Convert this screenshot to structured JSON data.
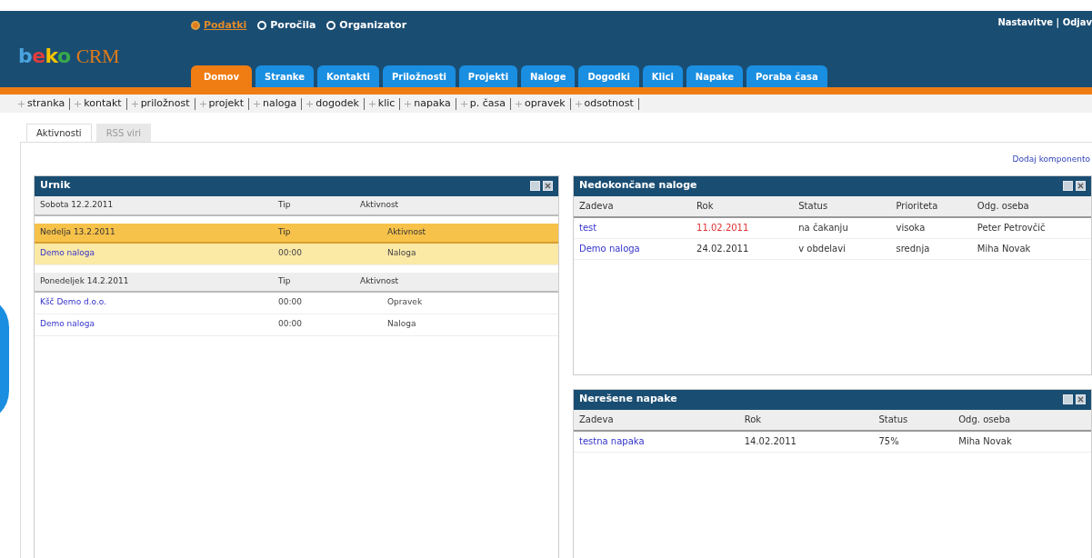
{
  "modules": [
    {
      "label": "Podatki",
      "selected": true
    },
    {
      "label": "Poročila",
      "selected": false
    },
    {
      "label": "Organizator",
      "selected": false
    }
  ],
  "user_links": "Nastavitve | Odjav",
  "logo": {
    "word": "beko",
    "suffix": "CRM"
  },
  "tabs": [
    {
      "label": "Domov",
      "selected": true
    },
    {
      "label": "Stranke",
      "selected": false
    },
    {
      "label": "Kontakti",
      "selected": false
    },
    {
      "label": "Priložnosti",
      "selected": false
    },
    {
      "label": "Projekti",
      "selected": false
    },
    {
      "label": "Naloge",
      "selected": false
    },
    {
      "label": "Dogodki",
      "selected": false
    },
    {
      "label": "Klici",
      "selected": false
    },
    {
      "label": "Napake",
      "selected": false
    },
    {
      "label": "Poraba časa",
      "selected": false
    }
  ],
  "quick_add": [
    "stranka",
    "kontakt",
    "priložnost",
    "projekt",
    "naloga",
    "dogodek",
    "klic",
    "napaka",
    "p. časa",
    "opravek",
    "odsotnost"
  ],
  "sub_tabs": [
    {
      "label": "Aktivnosti",
      "selected": true
    },
    {
      "label": "RSS viri",
      "selected": false
    }
  ],
  "add_component": "Dodaj komponento",
  "schedule": {
    "title": "Urnik",
    "days": [
      {
        "date": "Sobota 12.2.2011",
        "col_type": "Tip",
        "col_activity": "Aktivnost",
        "today": false
      },
      {
        "date": "Nedelja 13.2.2011",
        "col_type": "Tip",
        "col_activity": "Aktivnost",
        "today": true,
        "items": [
          {
            "name": "Demo naloga",
            "time": "00:00",
            "type": "Naloga"
          }
        ]
      },
      {
        "date": "Ponedeljek 14.2.2011",
        "col_type": "Tip",
        "col_activity": "Aktivnost",
        "today": false,
        "items": [
          {
            "name": "Kšč Demo d.o.o.",
            "time": "00:00",
            "type": "Opravek"
          },
          {
            "name": "Demo naloga",
            "time": "00:00",
            "type": "Naloga"
          }
        ]
      }
    ]
  },
  "open_tasks": {
    "title": "Nedokončane naloge",
    "columns": [
      "Zadeva",
      "Rok",
      "Status",
      "Prioriteta",
      "Odg. oseba"
    ],
    "rows": [
      {
        "cells": [
          "test",
          "11.02.2011",
          "na čakanju",
          "visoka",
          "Peter Petrovčič"
        ],
        "overdue": true
      },
      {
        "cells": [
          "Demo naloga",
          "24.02.2011",
          "v obdelavi",
          "srednja",
          "Miha Novak"
        ],
        "overdue": false
      }
    ]
  },
  "open_bugs": {
    "title": "Nerešene napake",
    "columns": [
      "Zadeva",
      "Rok",
      "Status",
      "Odg. oseba"
    ],
    "rows": [
      {
        "cells": [
          "testna napaka",
          "14.02.2011",
          "75%",
          "Miha Novak"
        ]
      }
    ]
  }
}
